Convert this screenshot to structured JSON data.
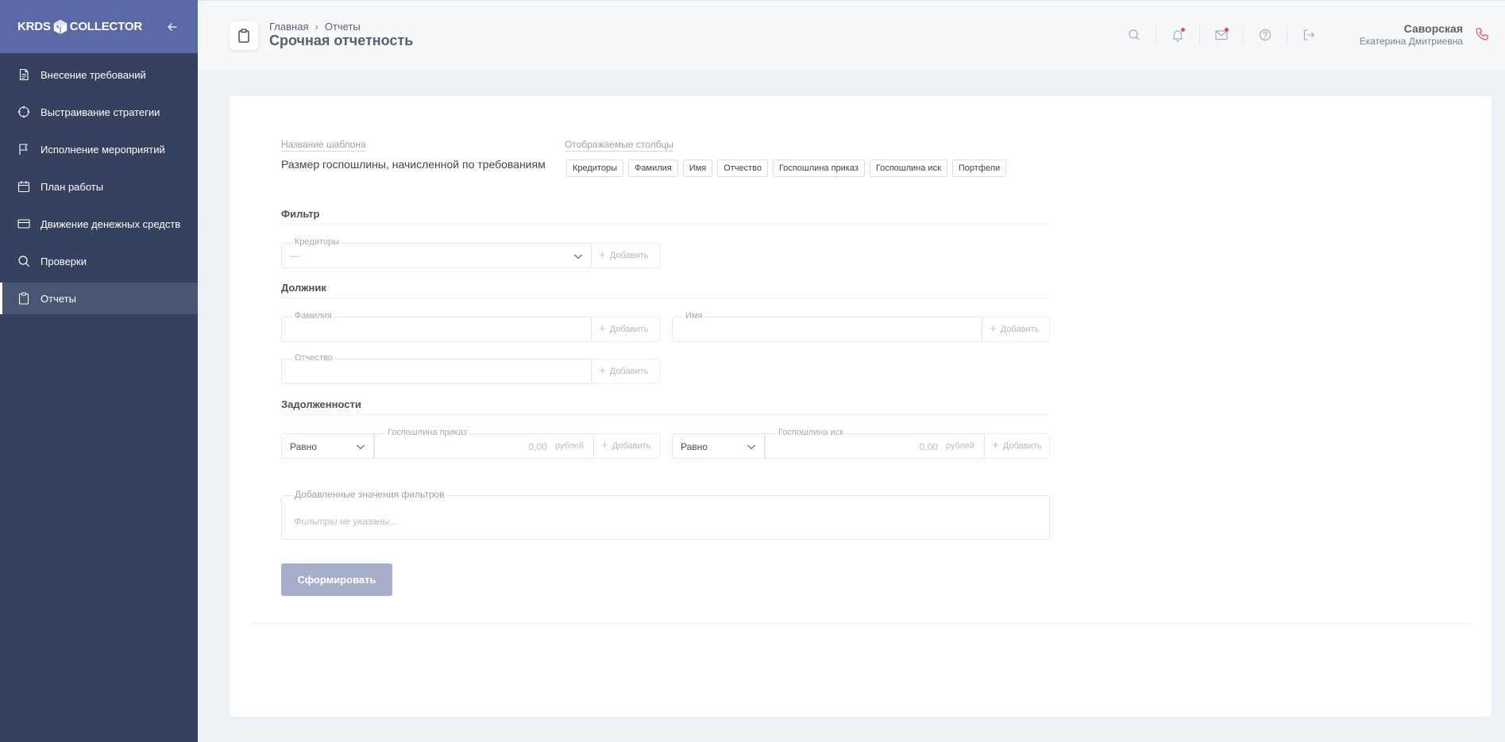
{
  "app": {
    "logo_left": "KRDS",
    "logo_right": "COLLECTOR"
  },
  "sidebar": {
    "items": [
      {
        "label": "Внесение требований",
        "icon": "document-icon"
      },
      {
        "label": "Выстраивание стратегии",
        "icon": "target-icon"
      },
      {
        "label": "Исполнение мероприятий",
        "icon": "flag-icon"
      },
      {
        "label": "План работы",
        "icon": "calendar-icon"
      },
      {
        "label": "Движение денежных средств",
        "icon": "credit-card-icon"
      },
      {
        "label": "Проверки",
        "icon": "search-icon"
      },
      {
        "label": "Отчеты",
        "icon": "clipboard-icon",
        "active": true
      }
    ]
  },
  "header": {
    "breadcrumb": [
      "Главная",
      "Отчеты"
    ],
    "breadcrumb_sep": "›",
    "title": "Срочная отчетность",
    "user_last_name": "Саворская",
    "user_first_name": "Екатерина Дмитриевна",
    "icons": [
      "search-icon",
      "bell-icon",
      "mail-icon",
      "help-icon",
      "logout-icon",
      "phone-icon"
    ]
  },
  "form": {
    "template_label": "Название шаблона",
    "template_value": "Размер госпошлины, начисленной по требованиям",
    "columns_label": "Отображаемые столбцы",
    "columns": [
      "Кредиторы",
      "Фамилия",
      "Имя",
      "Отчество",
      "Госпошлина приказ",
      "Госпошлина иск",
      "Портфели"
    ],
    "add_label": "Добавить",
    "sections": {
      "filter": "Фильтр",
      "debtor": "Должник",
      "debts": "Задолженности"
    },
    "creditors_label": "Кредиторы",
    "creditors_value": "—",
    "last_name_label": "Фамилия",
    "first_name_label": "Имя",
    "patronymic_label": "Отчество",
    "compare_value": "Равно",
    "duty_order_label": "Госпошлина приказ",
    "duty_claim_label": "Госпошлина иск",
    "amount_placeholder": "0,00",
    "currency_unit": "рублей",
    "added_filters_label": "Добавленные значения фильтров",
    "added_filters_empty": "Фильтры не указаны...",
    "submit_label": "Сформировать"
  },
  "colors": {
    "sidebar_bg": "#36405f",
    "sidebar_header_bg": "#5b69a6",
    "submit_disabled_bg": "#a6aecb",
    "notification_dot": "#e05050"
  }
}
